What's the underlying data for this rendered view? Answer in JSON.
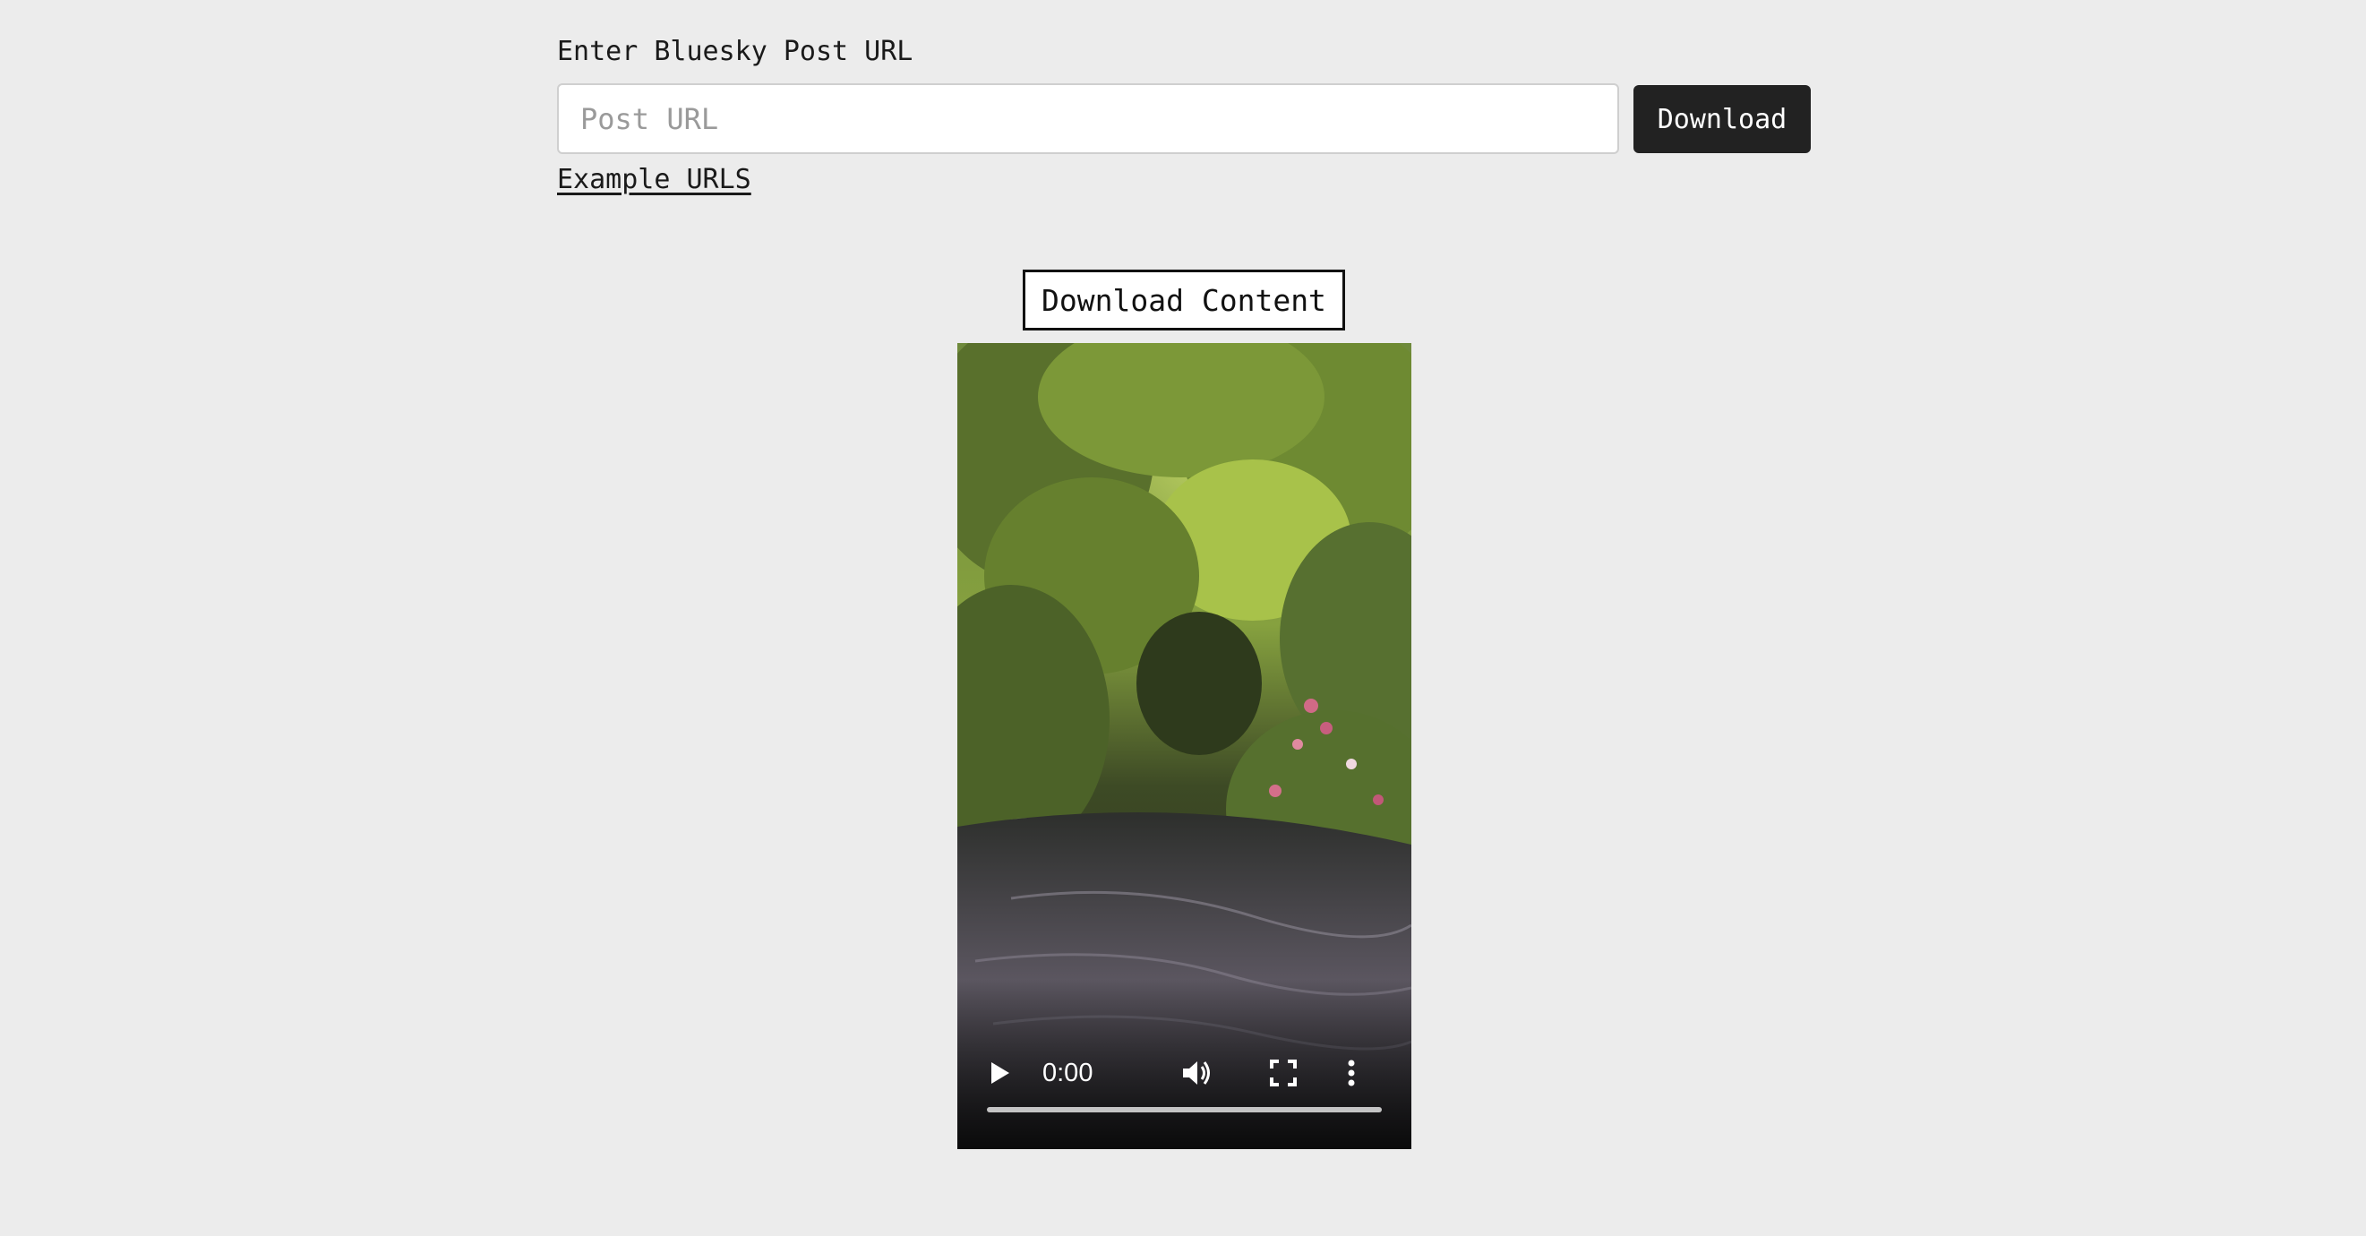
{
  "form": {
    "label": "Enter Bluesky Post URL",
    "input_value": "",
    "input_placeholder": "Post URL",
    "download_label": "Download",
    "example_link": "Example URLS"
  },
  "result": {
    "download_content_label": "Download Content",
    "video": {
      "current_time": "0:00",
      "progress": 0,
      "icons": [
        "play-icon",
        "volume-icon",
        "fullscreen-icon",
        "more-vert-icon"
      ]
    }
  }
}
